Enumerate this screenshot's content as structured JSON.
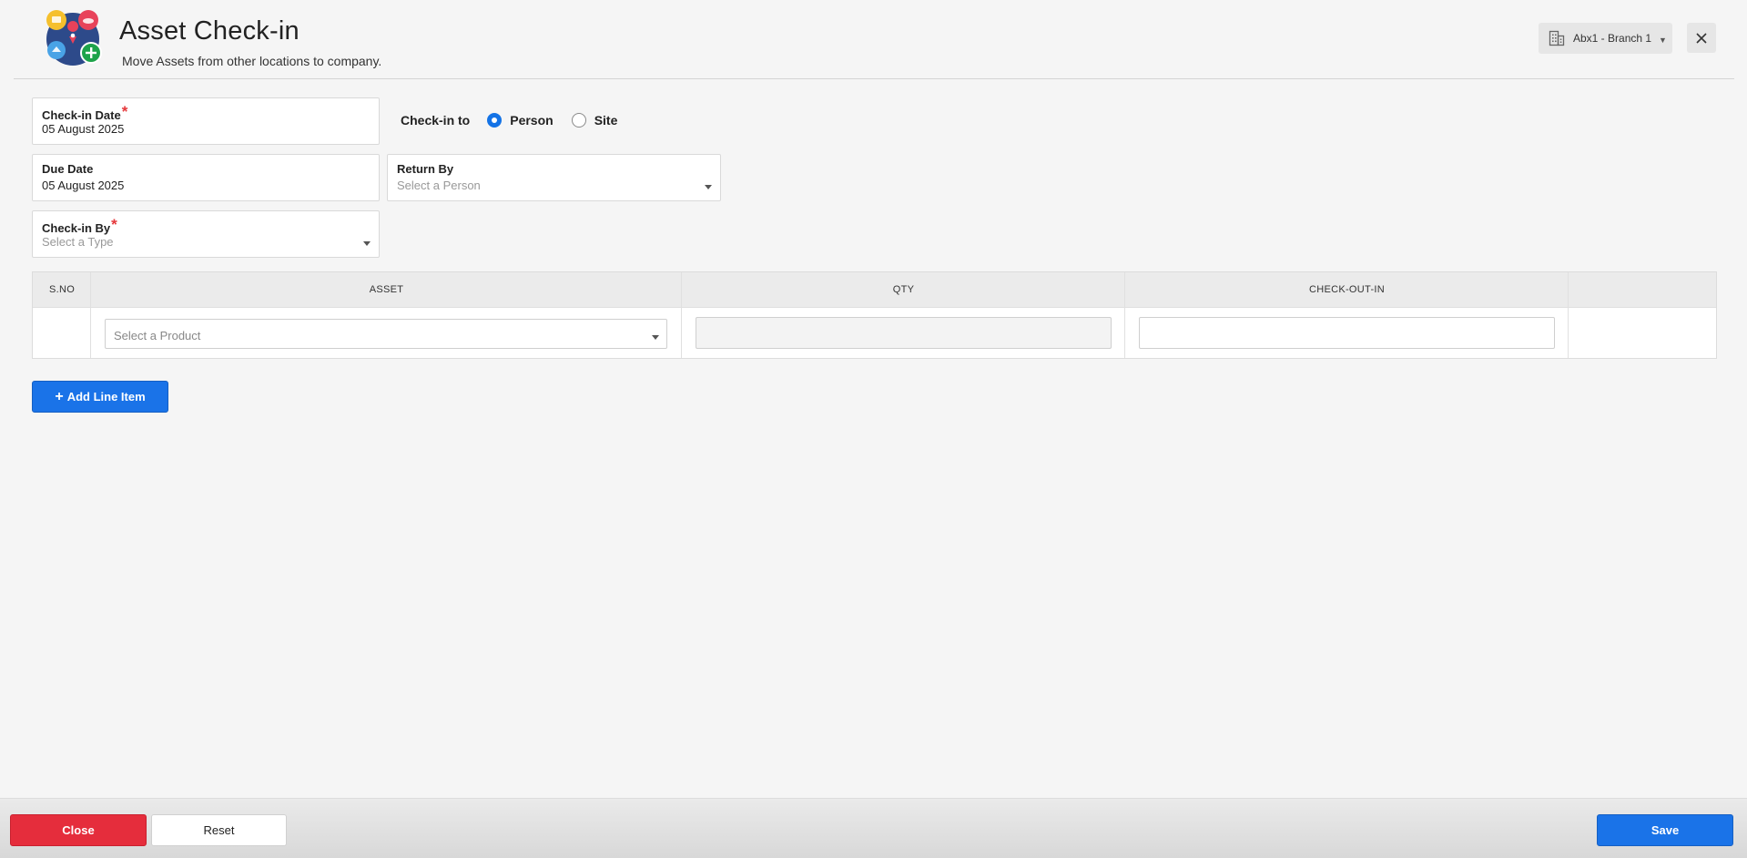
{
  "header": {
    "title": "Asset Check-in",
    "subtitle": "Move Assets from other locations to company.",
    "branch": "Abx1 - Branch 1"
  },
  "form": {
    "checkin_date": {
      "label": "Check-in Date",
      "required": "*",
      "value": "05 August 2025"
    },
    "checkin_to": {
      "label": "Check-in to",
      "options": [
        {
          "label": "Person",
          "selected": true
        },
        {
          "label": "Site",
          "selected": false
        }
      ]
    },
    "due_date": {
      "label": "Due Date",
      "value": "05 August 2025"
    },
    "return_by": {
      "label": "Return By",
      "placeholder": "Select a Person"
    },
    "checkin_by": {
      "label": "Check-in By",
      "required": "*",
      "placeholder": "Select a Type"
    }
  },
  "grid": {
    "columns": [
      "S.NO",
      "ASSET",
      "QTY",
      "CHECK-OUT-IN",
      ""
    ],
    "row": {
      "asset_placeholder": "Select a Product"
    }
  },
  "add_line_item": "Add Line Item",
  "footer": {
    "close": "Close",
    "reset": "Reset",
    "save": "Save"
  },
  "colors": {
    "primary": "#1a73e8",
    "danger": "#e52d3c",
    "required": "#e5383b"
  },
  "icons": {
    "logo": "asset-locations-logo",
    "branch": "building-icon",
    "close": "close-icon",
    "add": "plus-icon"
  }
}
